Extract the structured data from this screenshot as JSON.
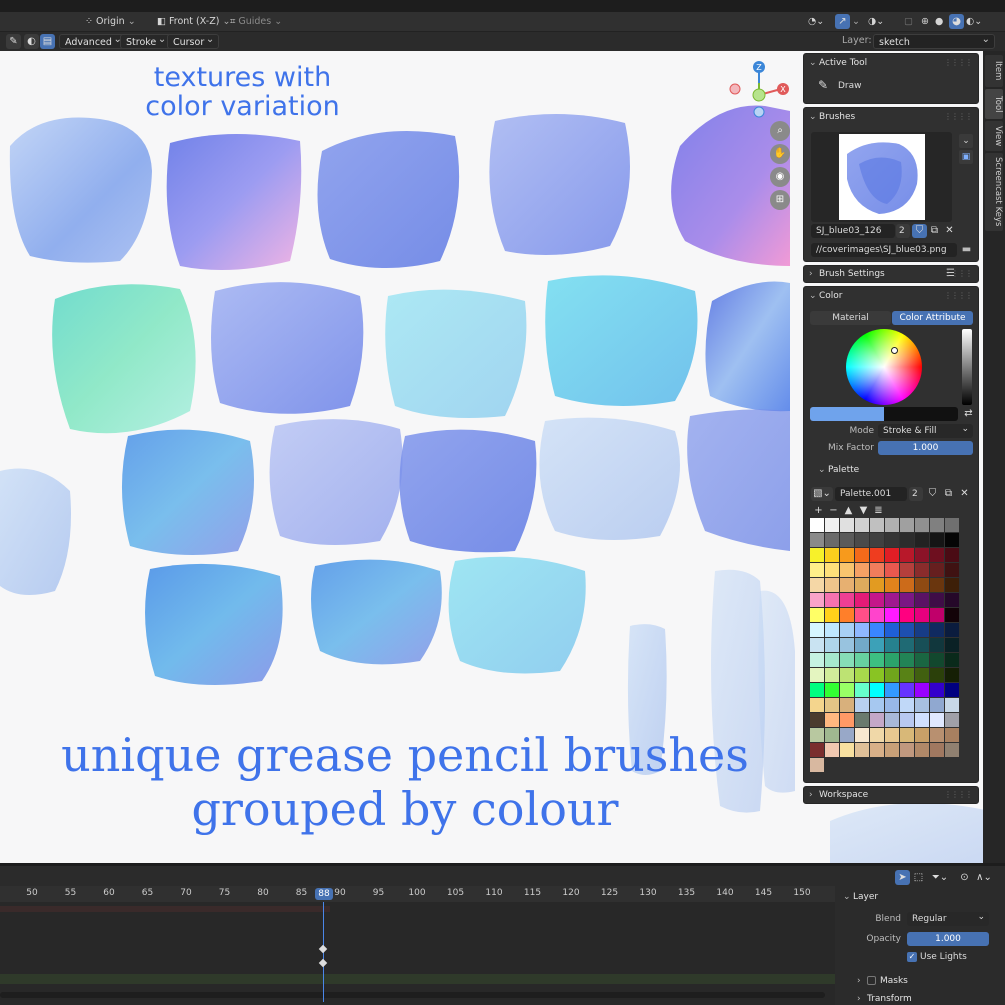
{
  "header": {
    "pivot": "Origin",
    "view": "Front (X-Z)",
    "guides": "Guides"
  },
  "toolbar": {
    "advanced": "Advanced",
    "stroke": "Stroke",
    "cursor": "Cursor",
    "layer_label": "Layer:",
    "layer_value": "sketch"
  },
  "viewport": {
    "caption_top_1": "textures with",
    "caption_top_2": "color variation",
    "caption_bottom_1": "unique grease pencil brushes",
    "caption_bottom_2": "grouped by colour",
    "gizmo": {
      "z": "Z",
      "x": "X"
    }
  },
  "sidetabs": [
    "Item",
    "Tool",
    "View",
    "Screencast Keys"
  ],
  "active_tool": {
    "title": "Active Tool",
    "tool": "Draw"
  },
  "brushes": {
    "title": "Brushes",
    "name": "SJ_blue03_126",
    "users": "2",
    "path": "//coverimages\\SJ_blue03.png"
  },
  "brush_settings": {
    "title": "Brush Settings"
  },
  "color": {
    "title": "Color",
    "tab_material": "Material",
    "tab_attribute": "Color Attribute",
    "mode_label": "Mode",
    "mode_value": "Stroke & Fill",
    "mix_label": "Mix Factor",
    "mix_value": "1.000",
    "primary": "#6fa3ec",
    "secondary": "#111111"
  },
  "palette": {
    "title": "Palette",
    "name": "Palette.001",
    "users": "2",
    "colors": [
      "#ffffff",
      "#f0f0f0",
      "#e0e0e0",
      "#d0d0d0",
      "#c0c0c0",
      "#b0b0b0",
      "#a0a0a0",
      "#909090",
      "#808080",
      "#707070",
      "#8a8a8a",
      "#6a6a6a",
      "#5a5a5a",
      "#4a4a4a",
      "#404040",
      "#353535",
      "#2c2c2c",
      "#222222",
      "#151515",
      "#050505",
      "#f7f12a",
      "#fbcf1d",
      "#f79a1c",
      "#f36a1a",
      "#ef3d1f",
      "#e01e25",
      "#b8182a",
      "#8b1328",
      "#6e0f1f",
      "#4a0b14",
      "#ffef8a",
      "#fde07a",
      "#f8c56f",
      "#f5a165",
      "#f17d5c",
      "#e8584f",
      "#b53f3c",
      "#8a2c2c",
      "#661f1f",
      "#3f1212",
      "#f5d7a6",
      "#efc58b",
      "#e7b071",
      "#deab5d",
      "#e29b21",
      "#e0831c",
      "#cc6b1a",
      "#8f4a12",
      "#6a360e",
      "#3d1f08",
      "#f9a3c8",
      "#f572b0",
      "#ee3f93",
      "#e41b77",
      "#c4178a",
      "#9f198f",
      "#7b1784",
      "#5a1264",
      "#3f0d47",
      "#250829",
      "#ffff66",
      "#ffd11a",
      "#ff7f2a",
      "#ff4f88",
      "#ff44cc",
      "#ff1aff",
      "#ff0080",
      "#e6007e",
      "#c0006a",
      "#130308",
      "#d6f6ff",
      "#bfe8ff",
      "#a8d0f5",
      "#8fb8ff",
      "#3a86ff",
      "#1f5fd8",
      "#1d4fb0",
      "#173c86",
      "#102a60",
      "#0b1c3e",
      "#c9e3f2",
      "#afd6ea",
      "#98c3df",
      "#72a9c8",
      "#3ca1b8",
      "#26818f",
      "#1f6a74",
      "#184f57",
      "#11373d",
      "#0a2125",
      "#c5f2e2",
      "#a6e8cd",
      "#86ddb7",
      "#67d1a0",
      "#3dbf82",
      "#2ba36b",
      "#228456",
      "#1a6642",
      "#12482e",
      "#0a2a1b",
      "#e4f5c0",
      "#d1ec9a",
      "#bde373",
      "#a8d94c",
      "#89c423",
      "#70a51c",
      "#588216",
      "#416010",
      "#2b400a",
      "#151f05",
      "#00ff80",
      "#33ff33",
      "#99ff66",
      "#66ffcc",
      "#00ffff",
      "#3399ff",
      "#6633ff",
      "#9900ff",
      "#3300cc",
      "#000080",
      "#f4d58d",
      "#e3c586",
      "#d8b07c",
      "#b8d0f0",
      "#a6c8f0",
      "#98b8e8",
      "#c0d8f8",
      "#a8c0e0",
      "#90a8d0",
      "#c8d8e8",
      "#4b3b2e",
      "#ffb880",
      "#ff9966",
      "#6a7a6e",
      "#c4a8c8",
      "#a8b8d8",
      "#b8c8f0",
      "#d0e0ff",
      "#e0e8ff",
      "#a0a0a8",
      "#b8c8a0",
      "#a0b890",
      "#98a8c8",
      "#f8e8d0",
      "#f0d8a8",
      "#e8c890",
      "#d8b878",
      "#c8a068",
      "#b89070",
      "#a88060",
      "#7a2e2e",
      "#f0c8b0",
      "#f8e0a0",
      "#e0c098",
      "#d8b088",
      "#c8a078",
      "#c0987e",
      "#b08868",
      "#a07860",
      "#908070",
      "#d8b8a0"
    ]
  },
  "workspace": {
    "title": "Workspace"
  },
  "timeline": {
    "frames": [
      "50",
      "55",
      "60",
      "65",
      "70",
      "75",
      "80",
      "85",
      "88",
      "90",
      "95",
      "100",
      "105",
      "110",
      "115",
      "120",
      "125",
      "130",
      "135",
      "140",
      "145",
      "150"
    ],
    "current": "88"
  },
  "layer_panel": {
    "title": "Layer",
    "blend_label": "Blend",
    "blend_value": "Regular",
    "opacity_label": "Opacity",
    "opacity_value": "1.000",
    "use_lights": "Use Lights",
    "masks": "Masks",
    "transform": "Transform"
  }
}
